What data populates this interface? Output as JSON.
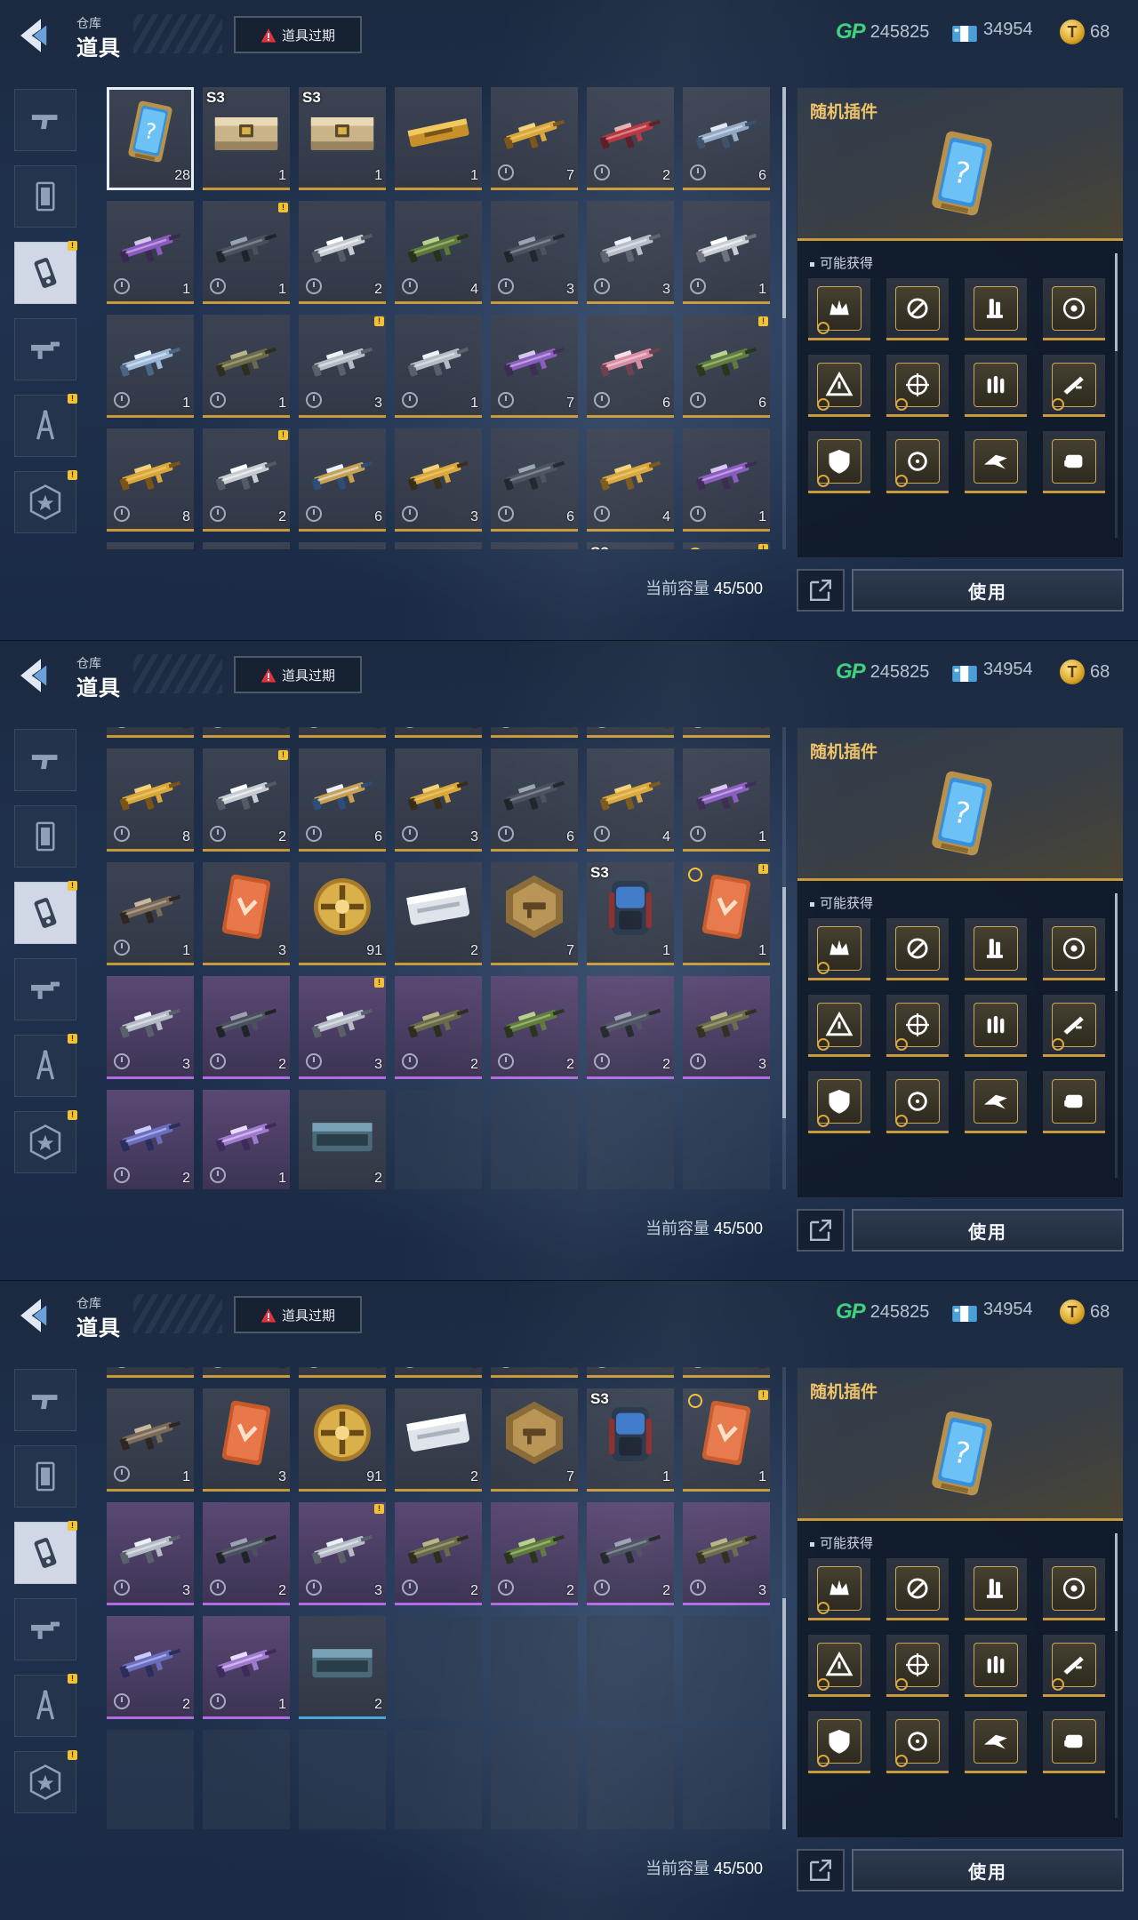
{
  "header": {
    "breadcrumb_sub": "仓库",
    "title": "道具",
    "expire_button": "道具过期"
  },
  "currency": {
    "gp_label": "GP",
    "gp_value": "245825",
    "ticket_value": "34954",
    "coin_value": "68"
  },
  "categories": [
    {
      "icon": "pistol-icon",
      "badge": false
    },
    {
      "icon": "card-frame-icon",
      "badge": false
    },
    {
      "icon": "plugin-chip-icon",
      "badge": true,
      "active": true
    },
    {
      "icon": "gun-parts-icon",
      "badge": false
    },
    {
      "icon": "compass-icon",
      "badge": true
    },
    {
      "icon": "star-badge-icon",
      "badge": true
    }
  ],
  "badge_mark": "!",
  "capacity": {
    "label": "当前容量",
    "value": "45/500"
  },
  "detail": {
    "name": "随机插件",
    "obtain_label": "可能获得",
    "use_button": "使用",
    "rewards": [
      "crown-plugin-icon",
      "scope-plugin-icon",
      "grip-plugin-icon",
      "target-plugin-icon",
      "warning-plugin-icon",
      "crosshair-plugin-icon",
      "ammo-plugin-icon",
      "barrel-plugin-icon",
      "shield-plugin-icon",
      "sight-plugin-icon",
      "bird-plugin-icon",
      "fist-plugin-icon"
    ]
  },
  "items": [
    {
      "kind": "plugin-card",
      "count": "28",
      "selected": true
    },
    {
      "kind": "crate",
      "count": "1",
      "tag": "S3"
    },
    {
      "kind": "crate",
      "count": "1",
      "tag": "S3"
    },
    {
      "kind": "gold-case",
      "count": "1"
    },
    {
      "kind": "rifle-gold",
      "count": "7",
      "timer": true
    },
    {
      "kind": "rifle-red",
      "count": "2",
      "timer": true
    },
    {
      "kind": "rifle-blue",
      "count": "6",
      "timer": true
    },
    {
      "kind": "rifle-purple",
      "count": "1",
      "timer": true
    },
    {
      "kind": "rifle-dark",
      "count": "1",
      "timer": true,
      "badge": true
    },
    {
      "kind": "smg-white",
      "count": "2",
      "timer": true
    },
    {
      "kind": "rifle-green",
      "count": "4",
      "timer": true
    },
    {
      "kind": "rifle-dark",
      "count": "3",
      "timer": true
    },
    {
      "kind": "rifle-silver",
      "count": "3",
      "timer": true
    },
    {
      "kind": "rifle-skeleton",
      "count": "1",
      "timer": true
    },
    {
      "kind": "rifle-ice",
      "count": "1",
      "timer": true
    },
    {
      "kind": "rifle-camo",
      "count": "1",
      "timer": true
    },
    {
      "kind": "rifle-silver",
      "count": "3",
      "timer": true,
      "badge": true
    },
    {
      "kind": "rifle-silver",
      "count": "1",
      "timer": true
    },
    {
      "kind": "rifle-purple",
      "count": "7",
      "timer": true
    },
    {
      "kind": "rifle-pink",
      "count": "6",
      "timer": true
    },
    {
      "kind": "rifle-green",
      "count": "6",
      "timer": true,
      "badge": true
    },
    {
      "kind": "rifle-gold",
      "count": "8",
      "timer": true
    },
    {
      "kind": "smg-white",
      "count": "2",
      "timer": true,
      "badge": true
    },
    {
      "kind": "spear-blue",
      "count": "6",
      "timer": true
    },
    {
      "kind": "sniper-gold",
      "count": "3",
      "timer": true
    },
    {
      "kind": "rifle-dark",
      "count": "6",
      "timer": true
    },
    {
      "kind": "rifle-gold",
      "count": "4",
      "timer": true
    },
    {
      "kind": "rifle-purple",
      "count": "1",
      "timer": true
    },
    {
      "kind": "revolver",
      "count": "1",
      "timer": true
    },
    {
      "kind": "orange-card",
      "count": "3"
    },
    {
      "kind": "gold-medal",
      "count": "91"
    },
    {
      "kind": "white-case",
      "count": "2"
    },
    {
      "kind": "hex-badge",
      "count": "7"
    },
    {
      "kind": "backpack",
      "count": "1",
      "tag": "S3"
    },
    {
      "kind": "orange-card",
      "count": "1",
      "topclock": true,
      "badge": true
    },
    {
      "kind": "rifle-silver",
      "count": "3",
      "timer": true,
      "rarity": "purple"
    },
    {
      "kind": "rifle-dark",
      "count": "2",
      "timer": true,
      "rarity": "purple"
    },
    {
      "kind": "rifle-silver",
      "count": "3",
      "timer": true,
      "rarity": "purple",
      "badge": true
    },
    {
      "kind": "rifle-camo",
      "count": "2",
      "timer": true,
      "rarity": "purple"
    },
    {
      "kind": "rifle-green",
      "count": "2",
      "timer": true,
      "rarity": "purple"
    },
    {
      "kind": "rifle-dark",
      "count": "2",
      "timer": true,
      "rarity": "purple"
    },
    {
      "kind": "rifle-camo",
      "count": "3",
      "timer": true,
      "rarity": "purple"
    },
    {
      "kind": "crossbow",
      "count": "2",
      "timer": true,
      "rarity": "purple"
    },
    {
      "kind": "blade-purple",
      "count": "1",
      "timer": true,
      "rarity": "purple"
    },
    {
      "kind": "steel-case",
      "count": "2",
      "rarity": "blue"
    }
  ],
  "colors": {
    "gold_accent": "#c99a3a",
    "purple_rarity": "#b26be0",
    "blue_rarity": "#4aa8d8",
    "gp_green": "#3fd27c",
    "badge_yellow": "#f2c230",
    "title_gold": "#efc36a"
  }
}
